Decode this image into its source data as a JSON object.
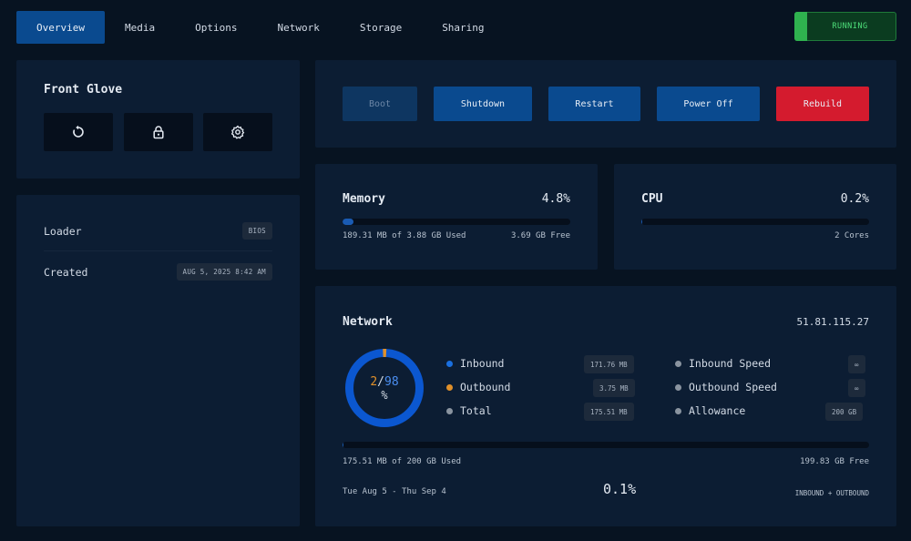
{
  "nav": {
    "tabs": [
      {
        "label": "Overview",
        "active": true
      },
      {
        "label": "Media"
      },
      {
        "label": "Options"
      },
      {
        "label": "Network"
      },
      {
        "label": "Storage"
      },
      {
        "label": "Sharing"
      }
    ],
    "status": "RUNNING"
  },
  "vm": {
    "name": "Front Glove",
    "icons": [
      "restart-icon",
      "lock-icon",
      "gear-icon"
    ]
  },
  "info": {
    "rows": [
      {
        "label": "Loader",
        "value": "BIOS"
      },
      {
        "label": "Created",
        "value": "AUG 5, 2025 8:42 AM"
      }
    ]
  },
  "actions": {
    "boot": "Boot",
    "shutdown": "Shutdown",
    "restart": "Restart",
    "power_off": "Power Off",
    "rebuild": "Rebuild"
  },
  "memory": {
    "title": "Memory",
    "percent": "4.8%",
    "fill": 0.048,
    "used": "189.31 MB of 3.88 GB Used",
    "free": "3.69 GB Free"
  },
  "cpu": {
    "title": "CPU",
    "percent": "0.2%",
    "fill": 0.002,
    "cores": "2 Cores"
  },
  "network": {
    "title": "Network",
    "ip": "51.81.115.27",
    "donut": {
      "used": "2",
      "sep": "/",
      "remaining": "98",
      "unit": "%",
      "used_fraction": 0.02
    },
    "inbound": {
      "label": "Inbound",
      "value": "171.76 MB"
    },
    "outbound": {
      "label": "Outbound",
      "value": "3.75 MB"
    },
    "total": {
      "label": "Total",
      "value": "175.51 MB"
    },
    "inbound_speed": {
      "label": "Inbound Speed",
      "value": "∞"
    },
    "outbound_speed": {
      "label": "Outbound Speed",
      "value": "∞"
    },
    "allowance": {
      "label": "Allowance",
      "value": "200 GB"
    },
    "usage_fill": 0.001,
    "used_text": "175.51 MB of 200 GB Used",
    "free_text": "199.83 GB Free",
    "period": "Tue Aug 5 - Thu Sep 4",
    "usage_percent": "0.1%",
    "scope": "INBOUND + OUTBOUND"
  },
  "colors": {
    "accent": "#0a4a8f",
    "danger": "#d41b2e",
    "inbound": "#1a6fe0",
    "outbound": "#e0902a",
    "neutral": "#8a94a0",
    "running": "#4ee07a"
  }
}
